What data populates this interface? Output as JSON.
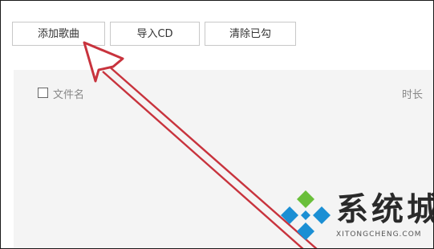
{
  "toolbar": {
    "add_song": "添加歌曲",
    "import_cd": "导入CD",
    "clear_played": "清除已勾"
  },
  "list": {
    "columns": {
      "name": "文件名",
      "duration": "时长"
    }
  },
  "watermark": {
    "title": "系统城",
    "domain": "XITONGCHENG.COM",
    "colors": {
      "green": "#6abf3a",
      "blue": "#1b8fd4"
    }
  },
  "annotation": {
    "arrow_color": "#c8333d"
  }
}
